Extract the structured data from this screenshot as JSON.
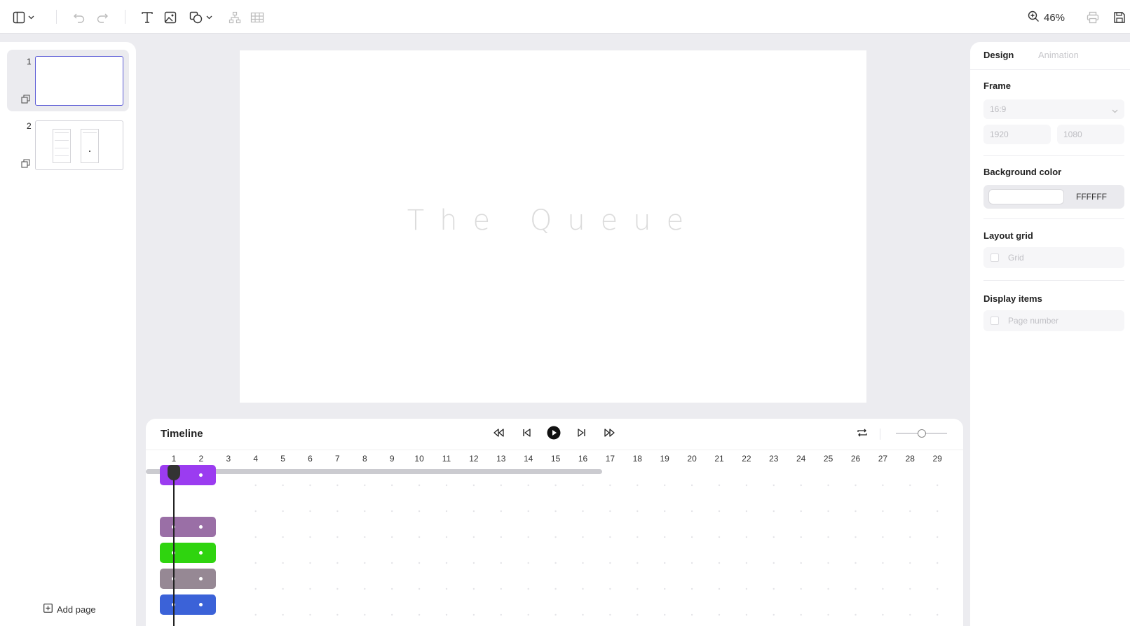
{
  "toolbar": {
    "icons": [
      "layout-icon",
      "chevron-down-icon",
      "undo-icon",
      "redo-icon",
      "text-icon",
      "image-icon",
      "shape-icon",
      "chevron-down-icon",
      "diagram-icon",
      "table-icon",
      "zoom-icon",
      "print-icon",
      "save-icon"
    ],
    "zoom_label": "46%"
  },
  "pages": {
    "items": [
      {
        "number": "1",
        "active": true
      },
      {
        "number": "2",
        "active": false
      }
    ],
    "add_label": "Add page"
  },
  "canvas": {
    "title": "The Queue",
    "background": "#ffffff"
  },
  "right_panel": {
    "tabs": {
      "design": "Design",
      "animation": "Animation"
    },
    "frame": {
      "title": "Frame",
      "ratio": "16:9",
      "width": "1920",
      "height": "1080"
    },
    "background": {
      "title": "Background color",
      "hex": "FFFFFF"
    },
    "layout_grid": {
      "title": "Layout grid",
      "grid_label": "Grid"
    },
    "display_items": {
      "title": "Display items",
      "page_number_label": "Page number"
    }
  },
  "timeline": {
    "title": "Timeline",
    "ruler": [
      "1",
      "2",
      "3",
      "4",
      "5",
      "6",
      "7",
      "8",
      "9",
      "10",
      "11",
      "12",
      "13",
      "14",
      "15",
      "16",
      "17",
      "18",
      "19",
      "20",
      "21",
      "22",
      "23",
      "24",
      "25",
      "26",
      "27",
      "28",
      "29"
    ],
    "playhead_position": "1",
    "tracks": [
      {
        "color": "#9b3cf0"
      },
      {
        "color": "#9a6fa6"
      },
      {
        "color": "#2fd40f"
      },
      {
        "color": "#968894"
      },
      {
        "color": "#3b62d8"
      }
    ]
  }
}
